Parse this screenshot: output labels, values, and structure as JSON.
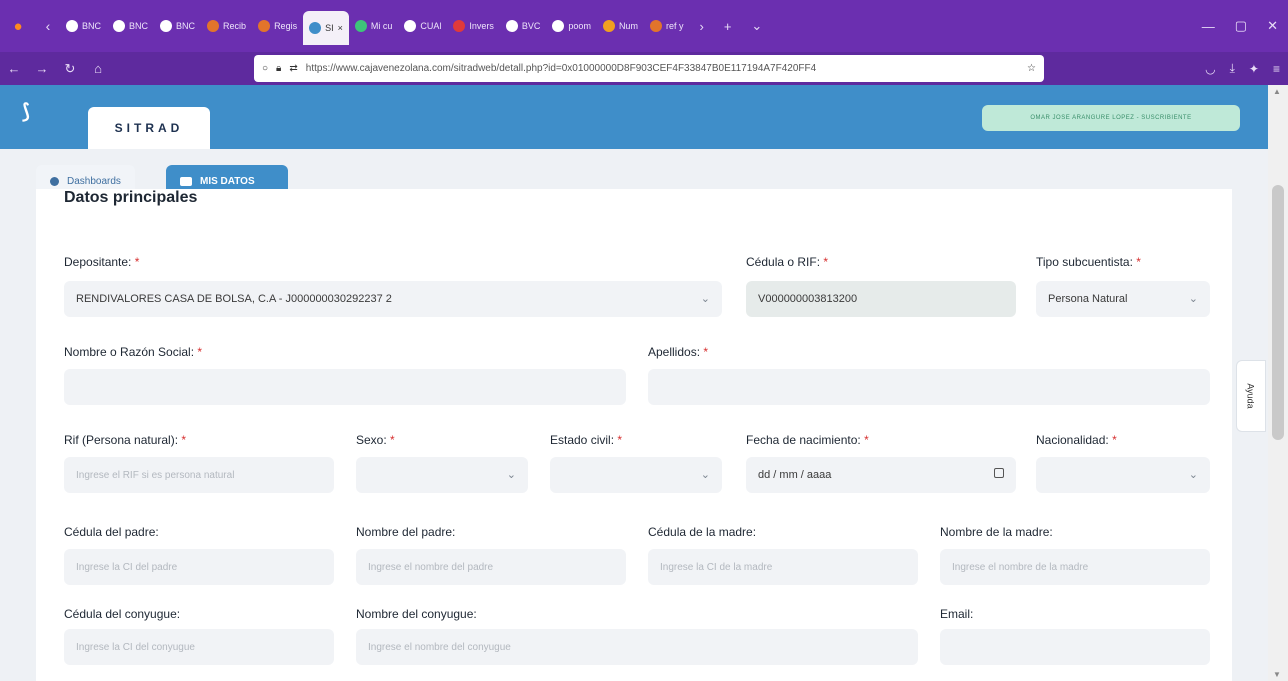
{
  "browser": {
    "tabs": [
      {
        "label": "BNC",
        "color": "#ffffff"
      },
      {
        "label": "BNC",
        "color": "#ffffff"
      },
      {
        "label": "BNC",
        "color": "#ffffff"
      },
      {
        "label": "Recib",
        "color": "#e2742b"
      },
      {
        "label": "Regis",
        "color": "#e2742b"
      },
      {
        "label": "SI",
        "color": "#3f8ec9",
        "active": true
      },
      {
        "label": "Mi cu",
        "color": "#3ec47a"
      },
      {
        "label": "CUAl",
        "color": "#ffffff"
      },
      {
        "label": "Invers",
        "color": "#e03a3a"
      },
      {
        "label": "BVC",
        "color": "#ffffff"
      },
      {
        "label": "poom",
        "color": "#ffffff"
      },
      {
        "label": "Num",
        "color": "#f0a020"
      },
      {
        "label": "ref y",
        "color": "#e2742b"
      }
    ],
    "url": "https://www.cajavenezolana.com/sitradweb/detall.php?id=0x01000000D8F903CEF4F33847B0E117194A7F420FF4"
  },
  "app": {
    "brand": "SITRAD",
    "user": "OMAR JOSE ARANGURE LOPEZ - SUSCRIBIENTE"
  },
  "subnav": {
    "dashboards": "Dashboards",
    "mis_datos": "MIS DATOS"
  },
  "form": {
    "section_title": "Datos principales",
    "depositante": {
      "label": "Depositante:",
      "value": "RENDIVALORES CASA DE BOLSA, C.A - J000000030292237 2"
    },
    "cedula_rif": {
      "label": "Cédula o RIF:",
      "value": "V000000003813200"
    },
    "tipo_subcuentista": {
      "label": "Tipo subcuentista:",
      "value": "Persona Natural"
    },
    "nombre_razon": {
      "label": "Nombre o Razón Social:",
      "value": ""
    },
    "apellidos": {
      "label": "Apellidos:",
      "value": ""
    },
    "rif_persona": {
      "label": "Rif (Persona natural):",
      "placeholder": "Ingrese el RIF si es persona natural"
    },
    "sexo": {
      "label": "Sexo:",
      "value": ""
    },
    "estado_civil": {
      "label": "Estado civil:",
      "value": ""
    },
    "fecha_nacimiento": {
      "label": "Fecha de nacimiento:",
      "value": "dd / mm / aaaa"
    },
    "nacionalidad": {
      "label": "Nacionalidad:",
      "value": ""
    },
    "cedula_padre": {
      "label": "Cédula del padre:",
      "placeholder": "Ingrese la CI del padre"
    },
    "nombre_padre": {
      "label": "Nombre del padre:",
      "placeholder": "Ingrese el nombre del padre"
    },
    "cedula_madre": {
      "label": "Cédula de la madre:",
      "placeholder": "Ingrese la CI de la madre"
    },
    "nombre_madre": {
      "label": "Nombre de la madre:",
      "placeholder": "Ingrese el nombre de la madre"
    },
    "cedula_conyugue": {
      "label": "Cédula del conyugue:",
      "placeholder": "Ingrese la CI del conyugue"
    },
    "nombre_conyugue": {
      "label": "Nombre del conyugue:",
      "placeholder": "Ingrese el nombre del conyugue"
    },
    "email": {
      "label": "Email:",
      "value": ""
    }
  },
  "ayuda": "Ayuda",
  "required_mark": "*"
}
